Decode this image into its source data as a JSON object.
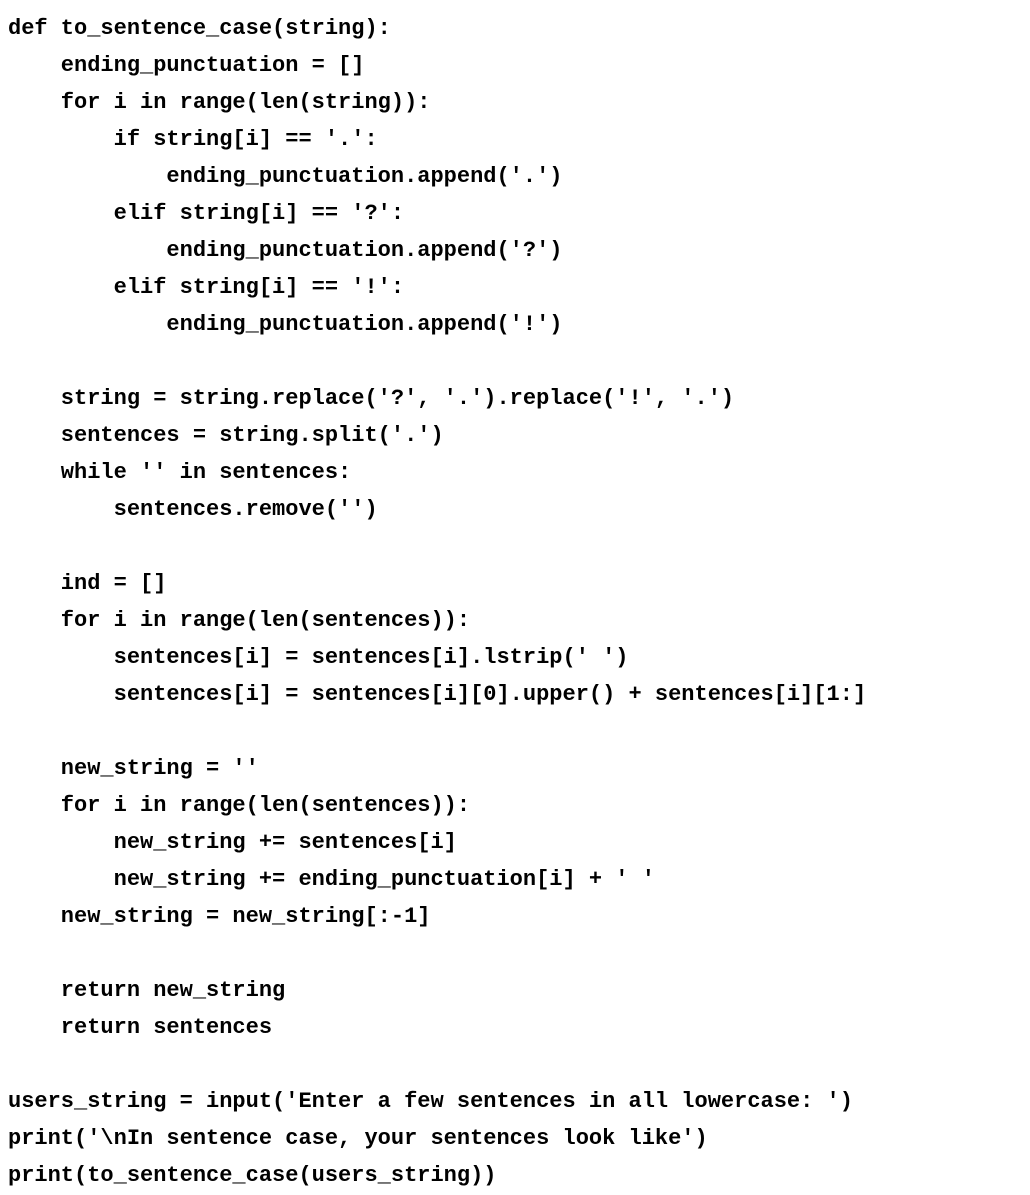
{
  "code": "def to_sentence_case(string):\n    ending_punctuation = []\n    for i in range(len(string)):\n        if string[i] == '.':\n            ending_punctuation.append('.')\n        elif string[i] == '?':\n            ending_punctuation.append('?')\n        elif string[i] == '!':\n            ending_punctuation.append('!')\n\n    string = string.replace('?', '.').replace('!', '.')\n    sentences = string.split('.')\n    while '' in sentences:\n        sentences.remove('')\n\n    ind = []\n    for i in range(len(sentences)):\n        sentences[i] = sentences[i].lstrip(' ')\n        sentences[i] = sentences[i][0].upper() + sentences[i][1:]\n\n    new_string = ''\n    for i in range(len(sentences)):\n        new_string += sentences[i]\n        new_string += ending_punctuation[i] + ' '\n    new_string = new_string[:-1]\n\n    return new_string\n    return sentences\n\nusers_string = input('Enter a few sentences in all lowercase: ')\nprint('\\nIn sentence case, your sentences look like')\nprint(to_sentence_case(users_string))"
}
